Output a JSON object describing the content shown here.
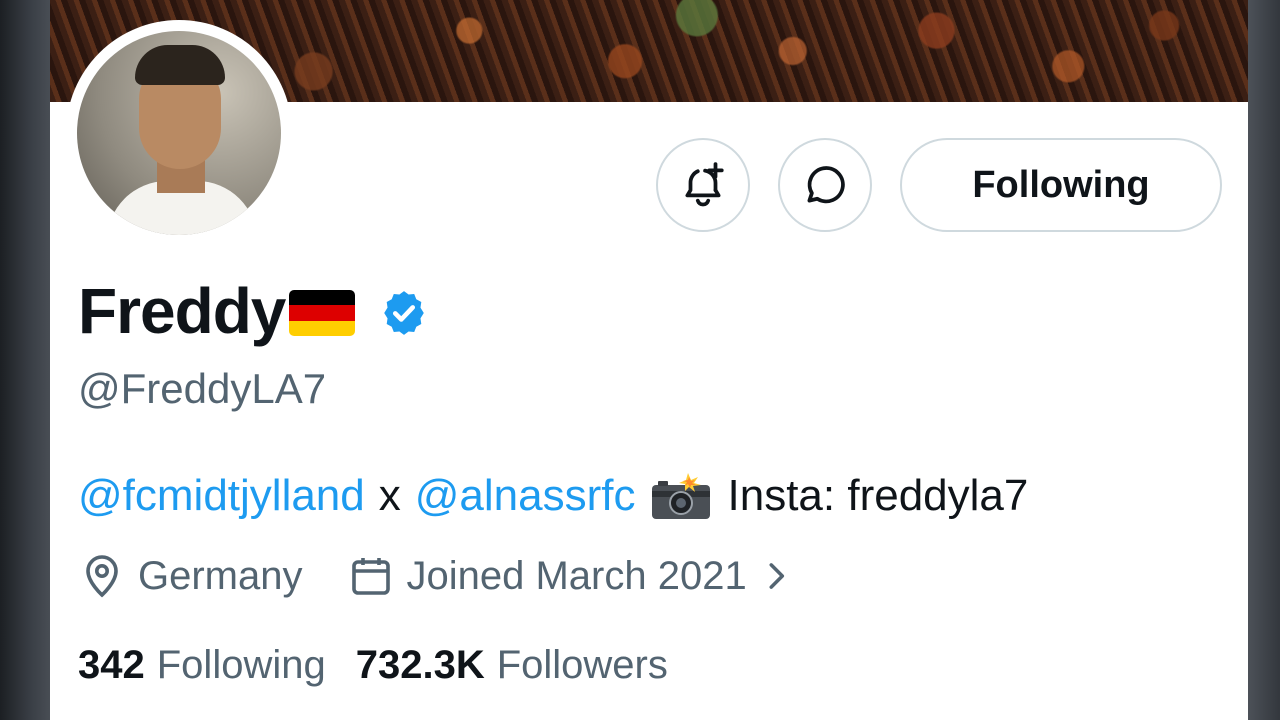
{
  "profile": {
    "display_name": "Freddy",
    "flag_icon": "germany-flag-icon",
    "flag_colors": [
      "#000000",
      "#dd0000",
      "#ffce00"
    ],
    "verified_icon": "verified-badge-icon",
    "verified_color": "#1d9bf0",
    "handle": "@FreddyLA7",
    "avatar_alt": "profile-photo"
  },
  "actions": {
    "notify_icon": "bell-plus-icon",
    "message_icon": "message-bubble-icon",
    "follow_label": "Following"
  },
  "bio": {
    "mention_1": "@fcmidtjylland",
    "separator": "x",
    "mention_2": "@alnassrfc",
    "camera_icon": "camera-flash-icon",
    "insta_text": "Insta: freddyla7"
  },
  "meta": {
    "location": "Germany",
    "location_icon": "location-pin-icon",
    "joined": "Joined March 2021",
    "joined_icon": "calendar-icon",
    "chevron_icon": "chevron-right-icon"
  },
  "stats": {
    "following_count": "342",
    "following_label": "Following",
    "followers_count": "732.3K",
    "followers_label": "Followers"
  },
  "colors": {
    "text_primary": "#0f1419",
    "text_secondary": "#536471",
    "link": "#1d9bf0",
    "border": "#cfd9de"
  }
}
